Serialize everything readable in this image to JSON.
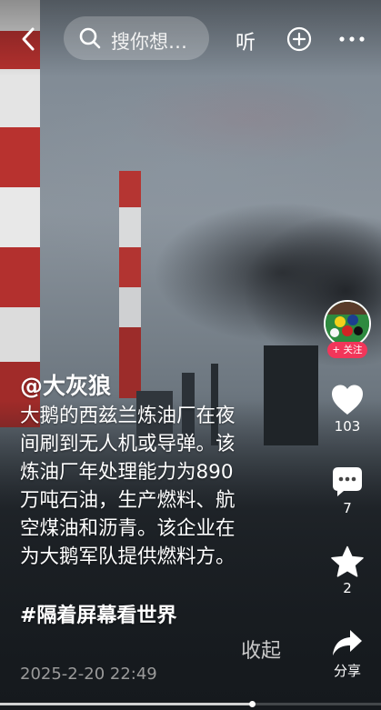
{
  "header": {
    "search_placeholder": "搜你想…",
    "listen_label": "听"
  },
  "author": {
    "handle": "@大灰狼",
    "follow_label": "+ 关注"
  },
  "actions": {
    "like_count": "103",
    "comment_count": "7",
    "favorite_count": "2",
    "share_label": "分享"
  },
  "caption": {
    "lines": [
      "大鹅的西兹兰炼油厂在夜",
      "间刷到无人机或导弹。该",
      "炼油厂年处理能力为890",
      "万吨石油，生产燃料、航",
      "空煤油和沥青。该企业在",
      "为大鹅军队提供燃料方。"
    ],
    "hashtag": "#隔着屏幕看世界",
    "collapse_label": "收起",
    "datetime": "2025-2-20 22:49"
  },
  "playback": {
    "progress": 0.66
  },
  "icons": {
    "back": "chevron-left-icon",
    "search": "search-icon",
    "add": "plus-circle-icon",
    "more": "more-icon",
    "like": "heart-icon",
    "comment": "comment-icon",
    "favorite": "star-icon",
    "share": "share-icon"
  }
}
